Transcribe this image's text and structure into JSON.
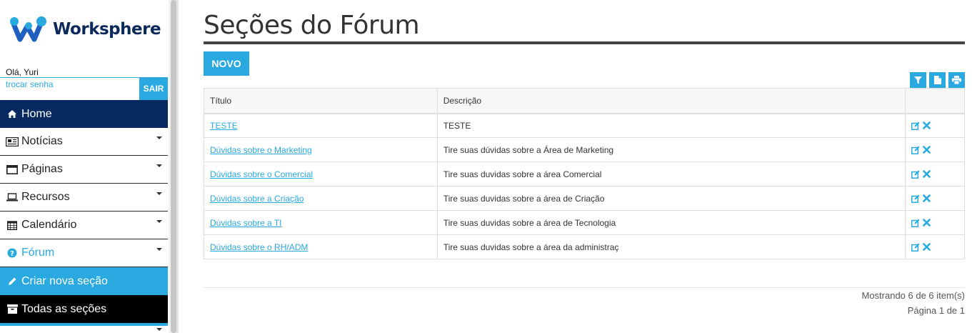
{
  "brand": {
    "name": "Worksphere"
  },
  "user": {
    "greeting": "Olá, Yuri",
    "change_password": "trocar senha",
    "logout": "SAIR"
  },
  "menu": [
    {
      "label": "Home",
      "icon": "home-icon"
    },
    {
      "label": "Notícias",
      "icon": "newspaper-icon"
    },
    {
      "label": "Páginas",
      "icon": "window-icon"
    },
    {
      "label": "Recursos",
      "icon": "laptop-icon"
    },
    {
      "label": "Calendário",
      "icon": "calendar-icon"
    },
    {
      "label": "Fórum",
      "icon": "question-circle-icon"
    },
    {
      "label": "Criar nova seção",
      "icon": "pencil-icon"
    },
    {
      "label": "Todas as seções",
      "icon": "archive-icon"
    }
  ],
  "main": {
    "title": "Seções do Fórum",
    "new_button": "NOVO",
    "table": {
      "headers": [
        "Título",
        "Descrição",
        ""
      ],
      "rows": [
        {
          "title": "TESTE",
          "description": "TESTE"
        },
        {
          "title": "Dúvidas sobre o Marketing",
          "description": "Tire suas dúvidas sobre a Área de Marketing"
        },
        {
          "title": "Dúvidas sobre o Comercial",
          "description": "Tire suas duvidas sobre a área Comercial"
        },
        {
          "title": "Dúvidas sobre a Criação",
          "description": "Tire suas duvidas sobre a área de Criação"
        },
        {
          "title": "Dúvidas sobre a TI",
          "description": "Tire suas duvidas sobre a área de Tecnologia"
        },
        {
          "title": "Dúvidas sobre o RH/ADM",
          "description": "Tire suas duvidas sobre a área da administraç"
        }
      ]
    },
    "showing": "Mostrando 6 de 6 item(s)",
    "page": "Página 1 de 1"
  },
  "colors": {
    "accent": "#29a9e0",
    "navy": "#062a5f",
    "black": "#000000"
  }
}
